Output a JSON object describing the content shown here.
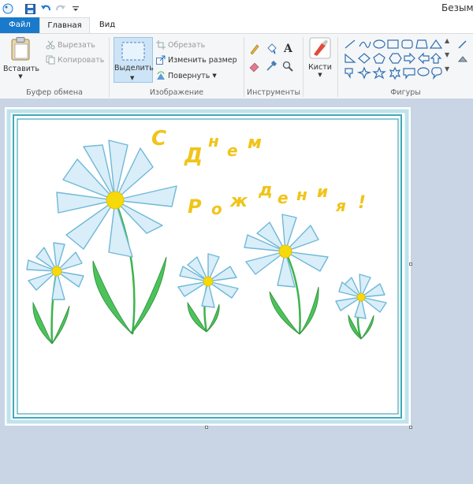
{
  "window": {
    "title": "Безым"
  },
  "tabs": [
    {
      "label": "Файл"
    },
    {
      "label": "Главная"
    },
    {
      "label": "Вид"
    }
  ],
  "clipboard": {
    "group_label": "Буфер обмена",
    "paste_label": "Вставить",
    "cut_label": "Вырезать",
    "copy_label": "Копировать"
  },
  "image": {
    "group_label": "Изображение",
    "select_label": "Выделить",
    "crop_label": "Обрезать",
    "resize_label": "Изменить размер",
    "rotate_label": "Повернуть"
  },
  "tools": {
    "group_label": "Инструменты"
  },
  "brushes": {
    "label": "Кисти"
  },
  "shapes": {
    "group_label": "Фигуры"
  },
  "drawing": {
    "line1": [
      "С",
      "Д",
      "н",
      "е",
      "м"
    ],
    "line2": [
      "Р",
      "о",
      "ж",
      "д",
      "е",
      "н",
      "и",
      "я",
      "!"
    ]
  },
  "colors": {
    "accent": "#1979ca",
    "frame": "#3fa9b8",
    "petal_fill": "#d9eef8",
    "petal_stroke": "#6fb8d8",
    "center": "#f5d90a",
    "stem": "#3cb44b",
    "text": "#f0c419"
  }
}
